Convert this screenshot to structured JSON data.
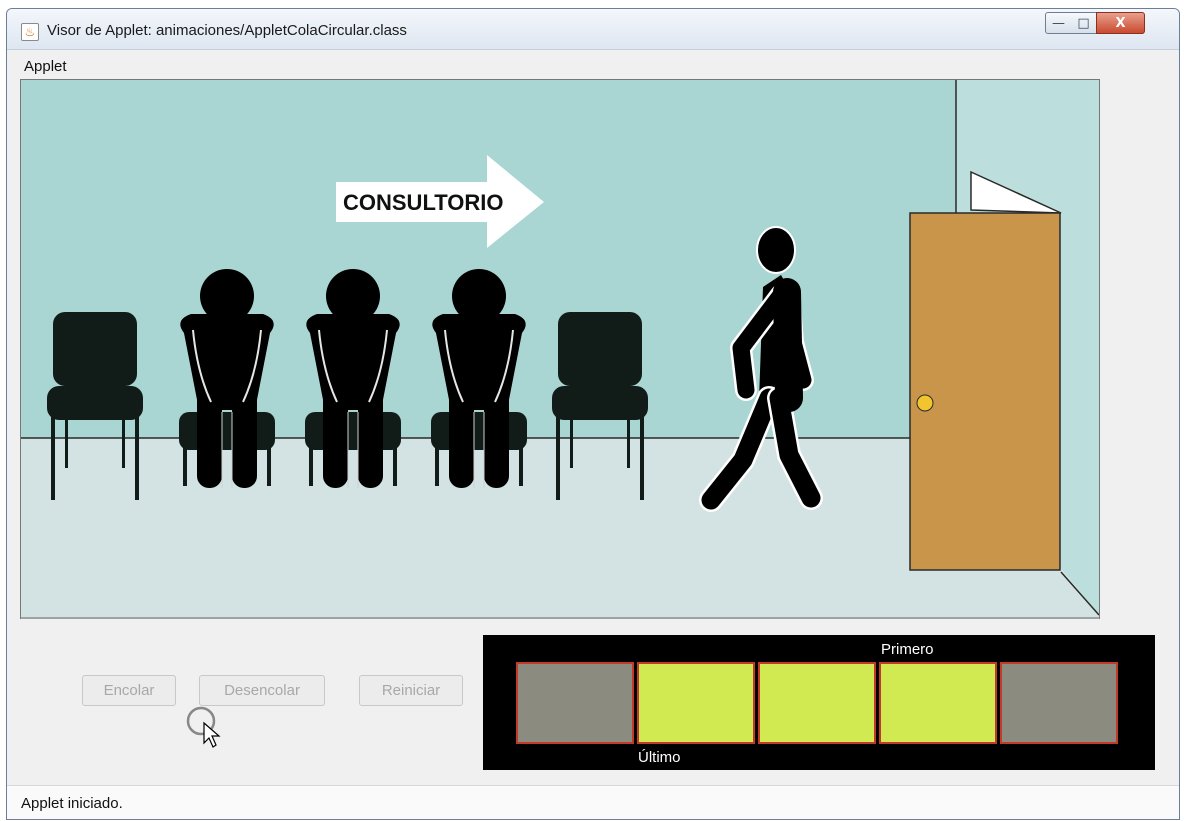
{
  "window": {
    "title": "Visor de Applet: animaciones/AppletColaCircular.class",
    "controls": {
      "minimize": "—",
      "maximize": "□",
      "close": "X"
    }
  },
  "menu": {
    "items": [
      "Applet"
    ]
  },
  "scene": {
    "sign_text": "CONSULTORIO"
  },
  "buttons": {
    "encolar": "Encolar",
    "desencolar": "Desencolar",
    "reiniciar": "Reiniciar"
  },
  "queue": {
    "first_label": "Primero",
    "last_label": "Último",
    "slots": [
      {
        "state": "empty",
        "color": "#8b8b80"
      },
      {
        "state": "occupied",
        "color": "#d2ea52"
      },
      {
        "state": "occupied",
        "color": "#d2ea52"
      },
      {
        "state": "occupied",
        "color": "#d2ea52"
      },
      {
        "state": "empty",
        "color": "#8b8b80"
      }
    ]
  },
  "status": {
    "text": "Applet iniciado."
  },
  "colors": {
    "wall": "#a9d5d3",
    "floor": "#d3e3e3",
    "door": "#c8954a",
    "slot_border": "#c23a2a"
  }
}
